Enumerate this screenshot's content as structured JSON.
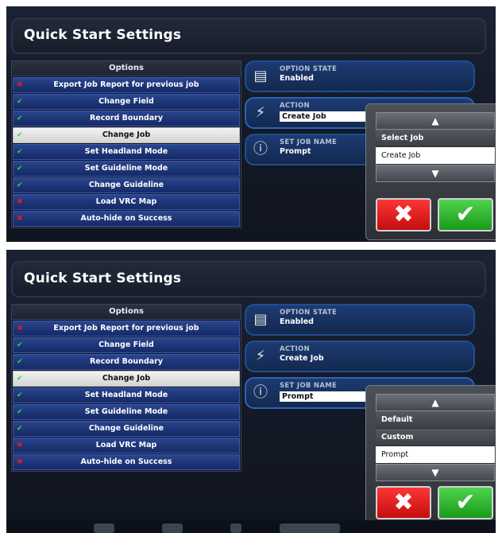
{
  "panels": [
    {
      "title": "Quick Start Settings",
      "options_header": "Options",
      "options": [
        {
          "label": "Export Job Report for previous job",
          "state": "x"
        },
        {
          "label": "Change Field",
          "state": "check"
        },
        {
          "label": "Record Boundary",
          "state": "check"
        },
        {
          "label": "Change Job",
          "state": "check",
          "selected": true
        },
        {
          "label": "Set Headland Mode",
          "state": "check"
        },
        {
          "label": "Set Guideline Mode",
          "state": "check"
        },
        {
          "label": "Change Guideline",
          "state": "check"
        },
        {
          "label": "Load VRC Map",
          "state": "x"
        },
        {
          "label": "Auto-hide on Success",
          "state": "x"
        }
      ],
      "cards": {
        "option_state_label": "OPTION STATE",
        "option_state_value": "Enabled",
        "action_label": "ACTION",
        "action_value": "Create Job",
        "set_job_name_label": "SET JOB NAME",
        "set_job_name_value": "Prompt"
      },
      "popup": {
        "items": [
          "Select Job",
          "Create Job"
        ],
        "selected_index": 1
      }
    },
    {
      "title": "Quick Start Settings",
      "options_header": "Options",
      "options": [
        {
          "label": "Export Job Report for previous job",
          "state": "x"
        },
        {
          "label": "Change Field",
          "state": "check"
        },
        {
          "label": "Record Boundary",
          "state": "check"
        },
        {
          "label": "Change Job",
          "state": "check",
          "selected": true
        },
        {
          "label": "Set Headland Mode",
          "state": "check"
        },
        {
          "label": "Set Guideline Mode",
          "state": "check"
        },
        {
          "label": "Change Guideline",
          "state": "check"
        },
        {
          "label": "Load VRC Map",
          "state": "x"
        },
        {
          "label": "Auto-hide on Success",
          "state": "x"
        }
      ],
      "cards": {
        "option_state_label": "OPTION STATE",
        "option_state_value": "Enabled",
        "action_label": "ACTION",
        "action_value": "Create Job",
        "set_job_name_label": "SET JOB NAME",
        "set_job_name_value": "Prompt"
      },
      "popup": {
        "items": [
          "Default",
          "Custom",
          "Prompt"
        ],
        "selected_index": 2
      }
    }
  ],
  "glyphs": {
    "x_mark": "✖",
    "check_mark": "✔",
    "up": "▲",
    "down": "▼",
    "cancel": "✖",
    "ok": "✔",
    "option_state_icon": "▤",
    "action_icon": "⚡",
    "info_icon": "ⓘ"
  },
  "colors": {
    "panel_bg": "#141a28",
    "row_blue": "#1d3574",
    "card_blue": "#13294f",
    "cancel_red": "#e02020",
    "ok_green": "#2bb52b"
  }
}
